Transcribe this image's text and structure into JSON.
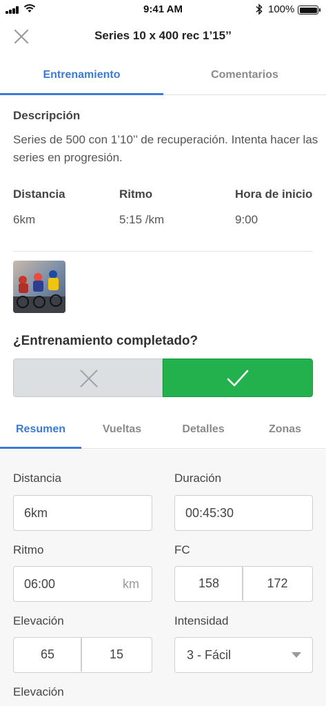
{
  "status_bar": {
    "time": "9:41 AM",
    "battery_percent": "100%",
    "icons": [
      "signal-icon",
      "wifi-icon",
      "bluetooth-icon",
      "battery-icon"
    ]
  },
  "header": {
    "title": "Series 10 x 400 rec 1’15’’",
    "close_icon": "close-icon"
  },
  "top_tabs": [
    {
      "label": "Entrenamiento",
      "active": true
    },
    {
      "label": "Comentarios",
      "active": false
    }
  ],
  "description": {
    "heading": "Descripción",
    "text": "Series de 500 con 1’10’’ de recuperación. Intenta hacer las series en progresión."
  },
  "stats": [
    {
      "label": "Distancia",
      "value": "6km"
    },
    {
      "label": "Ritmo",
      "value": "5:15 /km"
    },
    {
      "label": "Hora de inicio",
      "value": "9:00"
    }
  ],
  "photo": {
    "subject": "cyclists-photo"
  },
  "completion": {
    "question": "¿Entrenamiento completado?",
    "no_icon": "x-icon",
    "yes_icon": "check-icon",
    "selected": "yes",
    "colors": {
      "yes": "#22b14c",
      "no": "#dcdfe2"
    }
  },
  "bottom_tabs": [
    {
      "label": "Resumen",
      "active": true
    },
    {
      "label": "Vueltas",
      "active": false
    },
    {
      "label": "Detalles",
      "active": false
    },
    {
      "label": "Zonas",
      "active": false
    }
  ],
  "summary": {
    "distance": {
      "label": "Distancia",
      "value": "6km"
    },
    "duration": {
      "label": "Duración",
      "value": "00:45:30"
    },
    "pace": {
      "label": "Ritmo",
      "value": "06:00",
      "unit": "km"
    },
    "hr": {
      "label": "FC",
      "values": [
        "158",
        "172"
      ]
    },
    "elevation": {
      "label": "Elevación",
      "values": [
        "65",
        "15"
      ]
    },
    "intensity": {
      "label": "Intensidad",
      "value": "3 - Fácil"
    },
    "elevation2": {
      "label": "Elevación"
    }
  },
  "accent_color": "#3a7bd5"
}
